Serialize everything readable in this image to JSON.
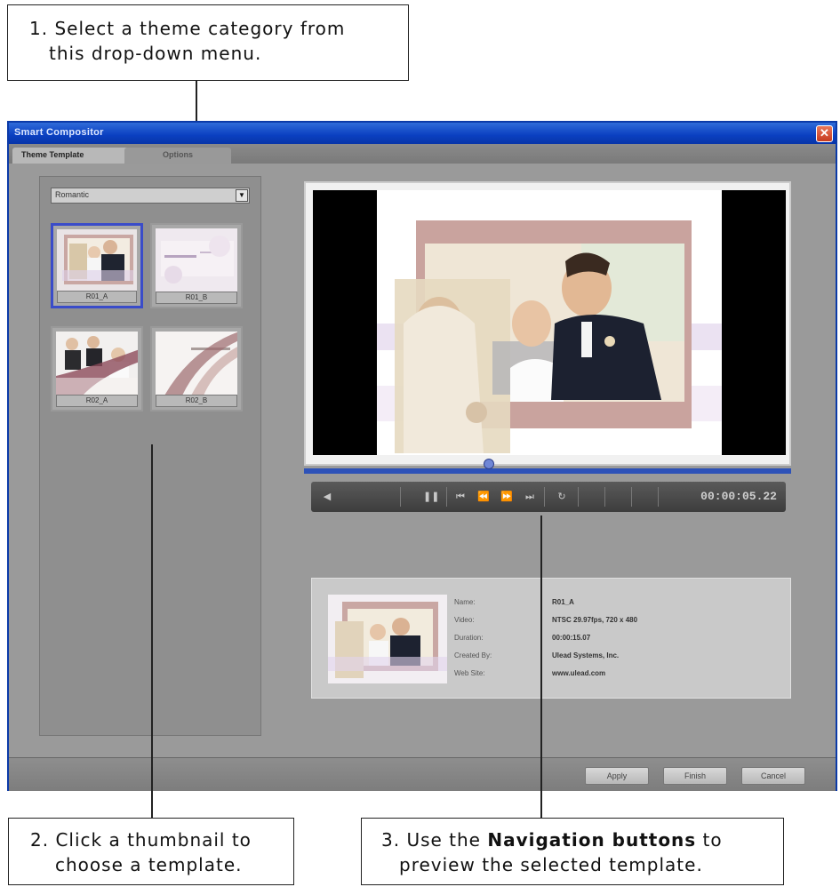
{
  "callouts": {
    "step1_line1": "1. Select a theme category from",
    "step1_line2": "this drop-down menu.",
    "step2_line1": "2. Click a thumbnail to",
    "step2_line2": "choose a template.",
    "step3_prefix": "3. Use the ",
    "step3_bold": "Navigation buttons",
    "step3_suffix": " to",
    "step3_line2": "preview the selected template."
  },
  "window": {
    "title": "Smart Compositor",
    "close_glyph": "✕"
  },
  "tabs": [
    {
      "label": "Theme Template"
    },
    {
      "label": "Options"
    }
  ],
  "theme_dropdown": {
    "selected": "Romantic",
    "arrow_glyph": "▼"
  },
  "thumbnails": [
    {
      "label": "R01_A",
      "selected": true
    },
    {
      "label": "R01_B",
      "selected": false
    },
    {
      "label": "R02_A",
      "selected": false
    },
    {
      "label": "R02_B",
      "selected": false
    }
  ],
  "player": {
    "timecode": "00:00:05.22",
    "icons": [
      "volume-icon",
      "pause-icon",
      "previous-icon",
      "rewind-icon",
      "fast-forward-icon",
      "next-icon",
      "loop-icon"
    ]
  },
  "info": {
    "rows": [
      {
        "label": "Name:",
        "value": "R01_A"
      },
      {
        "label": "Video:",
        "value": "NTSC 29.97fps, 720 x 480"
      },
      {
        "label": "Duration:",
        "value": "00:00:15.07"
      },
      {
        "label": "Created By:",
        "value": "Ulead Systems, Inc."
      },
      {
        "label": "Web Site:",
        "value": "www.ulead.com"
      }
    ]
  },
  "buttons": {
    "apply": "Apply",
    "finish": "Finish",
    "cancel": "Cancel"
  },
  "colors": {
    "titlebar": "#0a3fc0",
    "selection_border": "#3a4cc9",
    "progress": "#2e52b8"
  }
}
